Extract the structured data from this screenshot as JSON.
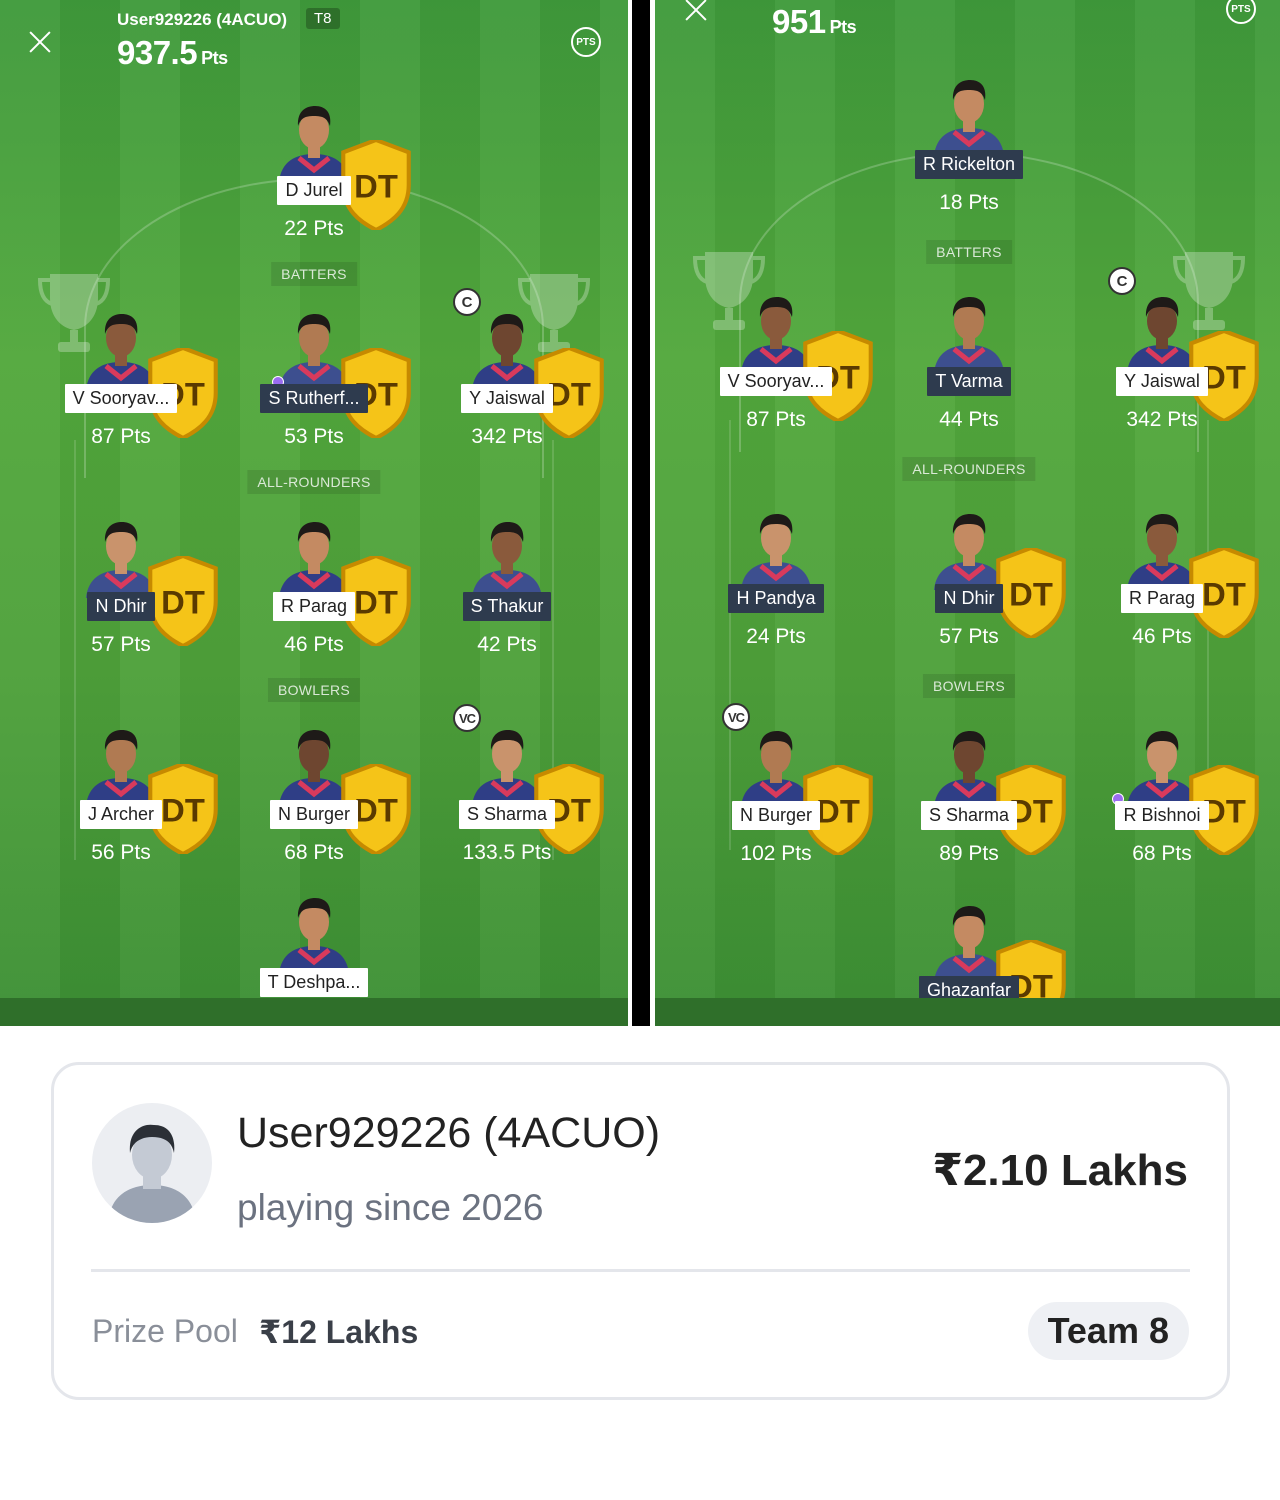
{
  "left_team": {
    "user": "User929226 (4ACUO)",
    "tag": "T8",
    "points": "937.5",
    "points_unit": "Pts",
    "pts_icon": "PTS",
    "sections": {
      "batters": "BATTERS",
      "allrounders": "ALL-ROUNDERS",
      "bowlers": "BOWLERS"
    },
    "players": [
      {
        "name": "D Jurel",
        "pts": "22 Pts",
        "role": "wk"
      },
      {
        "name": "V Sooryav...",
        "pts": "87 Pts",
        "role": "bat"
      },
      {
        "name": "S Rutherf...",
        "pts": "53 Pts",
        "role": "bat"
      },
      {
        "name": "Y Jaiswal",
        "pts": "342 Pts",
        "role": "bat",
        "captain": "C"
      },
      {
        "name": "N Dhir",
        "pts": "57 Pts",
        "role": "ar"
      },
      {
        "name": "R Parag",
        "pts": "46 Pts",
        "role": "ar"
      },
      {
        "name": "S Thakur",
        "pts": "42 Pts",
        "role": "ar"
      },
      {
        "name": "J Archer",
        "pts": "56 Pts",
        "role": "bowl"
      },
      {
        "name": "N Burger",
        "pts": "68 Pts",
        "role": "bowl"
      },
      {
        "name": "S Sharma",
        "pts": "133.5 Pts",
        "role": "bowl",
        "captain": "VC"
      },
      {
        "name": "T Deshpa...",
        "pts": "",
        "role": "bowl"
      }
    ]
  },
  "right_team": {
    "points": "951",
    "points_unit": "Pts",
    "pts_icon": "PTS",
    "sections": {
      "batters": "BATTERS",
      "allrounders": "ALL-ROUNDERS",
      "bowlers": "BOWLERS"
    },
    "players": [
      {
        "name": "R Rickelton",
        "pts": "18 Pts",
        "role": "wk"
      },
      {
        "name": "V Sooryav...",
        "pts": "87 Pts",
        "role": "bat"
      },
      {
        "name": "T Varma",
        "pts": "44 Pts",
        "role": "bat"
      },
      {
        "name": "Y Jaiswal",
        "pts": "342 Pts",
        "role": "bat",
        "captain": "C"
      },
      {
        "name": "H Pandya",
        "pts": "24 Pts",
        "role": "ar"
      },
      {
        "name": "N Dhir",
        "pts": "57 Pts",
        "role": "ar"
      },
      {
        "name": "R Parag",
        "pts": "46 Pts",
        "role": "ar"
      },
      {
        "name": "N Burger",
        "pts": "102 Pts",
        "role": "bowl",
        "captain": "VC"
      },
      {
        "name": "S Sharma",
        "pts": "89 Pts",
        "role": "bowl"
      },
      {
        "name": "R Bishnoi",
        "pts": "68 Pts",
        "role": "bowl"
      },
      {
        "name": "Ghazanfar",
        "pts": "",
        "role": "bowl"
      }
    ]
  },
  "badges": {
    "dt": "DT"
  },
  "colors": {
    "pitch": "#4ea13a",
    "team_light": "#ffffff",
    "team_dark": "#2e3b4e",
    "substitute_dot": "#9a6cf0"
  },
  "card": {
    "user_name": "User929226 (4ACUO)",
    "since": "playing since 2026",
    "winnings": "₹2.10 Lakhs",
    "pool_label": "Prize Pool",
    "pool_value": "₹12 Lakhs",
    "team_label": "Team 8"
  }
}
